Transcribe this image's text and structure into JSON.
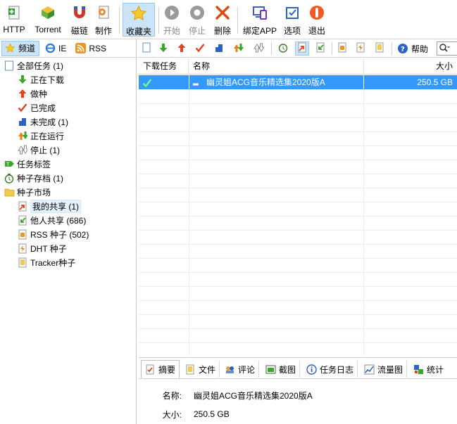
{
  "toolbar": {
    "http": "HTTP",
    "torrent": "Torrent",
    "magnet": "磁链",
    "create": "制作",
    "favorites": "收藏夹",
    "start": "开始",
    "stop": "停止",
    "delete": "删除",
    "bind_app": "绑定APP",
    "options": "选项",
    "exit": "退出"
  },
  "left_tabs": {
    "channel": "频道",
    "ie": "IE",
    "rss": "RSS"
  },
  "tree": {
    "all_tasks": "全部任务 (1)",
    "downloading": "正在下载",
    "seeding": "做种",
    "completed": "已完成",
    "incomplete": "未完成 (1)",
    "running": "正在运行",
    "stopped": "停止 (1)",
    "task_tags": "任务标签",
    "torrent_archive": "种子存档 (1)",
    "torrent_market": "种子市场",
    "my_shares": "我的共享 (1)",
    "others_shares": "他人共享 (686)",
    "rss_torrents": "RSS 种子 (502)",
    "dht_torrents": "DHT 种子",
    "tracker_torrents": "Tracker种子"
  },
  "right_toolbar": {
    "help": "帮助"
  },
  "task_list": {
    "columns": [
      "下载任务",
      "名称",
      "大小"
    ],
    "rows": [
      {
        "name": "幽灵姐ACG音乐精选集2020版A",
        "size": "250.5 GB"
      }
    ]
  },
  "detail_tabs": [
    "摘要",
    "文件",
    "评论",
    "截图",
    "任务日志",
    "流量图",
    "统计"
  ],
  "detail": {
    "name_label": "名称:",
    "name_value": "幽灵姐ACG音乐精选集2020版A",
    "size_label": "大小:",
    "size_value": "250.5 GB"
  },
  "colors": {
    "selection": "#3399ff",
    "active_button": "#cce4f7"
  }
}
